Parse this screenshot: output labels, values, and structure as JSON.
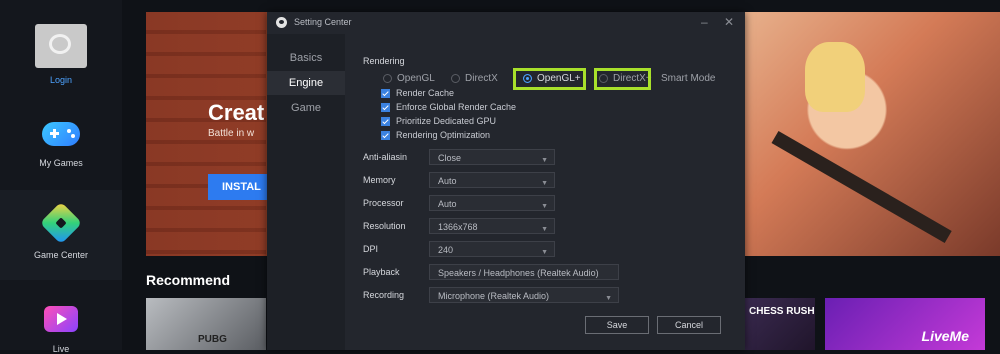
{
  "sidebar": {
    "items": [
      {
        "label": "Login",
        "icon": "avatar-icon"
      },
      {
        "label": "My Games",
        "icon": "gamepad-icon"
      },
      {
        "label": "Game Center",
        "icon": "game-center-icon"
      },
      {
        "label": "Live",
        "icon": "live-icon"
      }
    ]
  },
  "main": {
    "banner_title": "Creat",
    "banner_subtitle": "Battle in w",
    "install_label": "INSTAL",
    "recommend_title": "Recommend",
    "thumbs": [
      "PUBG",
      "CHESS RUSH",
      "LiveMe"
    ]
  },
  "dialog": {
    "title": "Setting Center",
    "minimize": "–",
    "close": "✕",
    "nav": [
      "Basics",
      "Engine",
      "Game"
    ],
    "active_nav": "Engine",
    "rendering": {
      "title": "Rendering",
      "modes": [
        {
          "label": "OpenGL",
          "checked": false
        },
        {
          "label": "DirectX",
          "checked": false
        },
        {
          "label": "OpenGL+",
          "checked": true
        },
        {
          "label": "DirectX+",
          "checked": false
        },
        {
          "label": "Smart Mode",
          "checked": false
        }
      ],
      "highlight_color": "#a8e02b",
      "checkboxes": [
        {
          "label": "Render Cache",
          "checked": true
        },
        {
          "label": "Enforce Global Render Cache",
          "checked": true
        },
        {
          "label": "Prioritize Dedicated GPU",
          "checked": true
        },
        {
          "label": "Rendering Optimization",
          "checked": true
        }
      ]
    },
    "fields": [
      {
        "label": "Anti-aliasin",
        "value": "Close"
      },
      {
        "label": "Memory",
        "value": "Auto"
      },
      {
        "label": "Processor",
        "value": "Auto"
      },
      {
        "label": "Resolution",
        "value": "1366x768"
      },
      {
        "label": "DPI",
        "value": "240"
      },
      {
        "label": "Playback",
        "value": "Speakers / Headphones (Realtek Audio)"
      },
      {
        "label": "Recording",
        "value": "Microphone (Realtek Audio)"
      }
    ],
    "save_label": "Save",
    "cancel_label": "Cancel",
    "accent_color": "#3b82e0"
  }
}
